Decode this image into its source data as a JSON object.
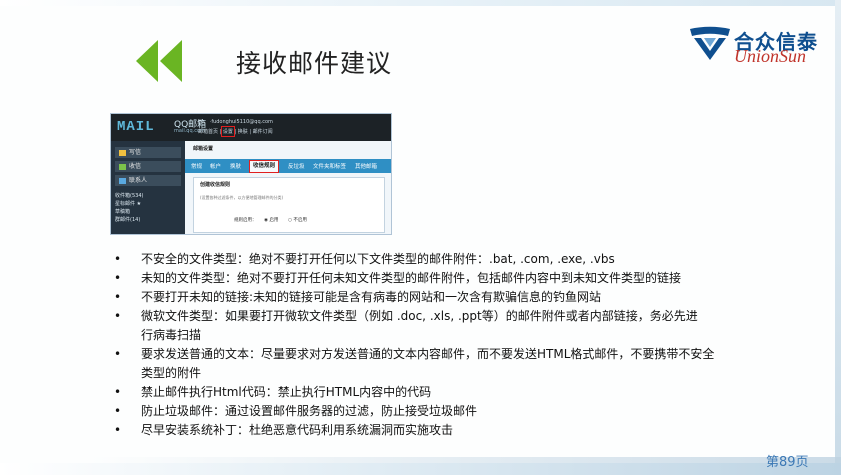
{
  "slide": {
    "title": "接收邮件建议",
    "page_label": "第89页"
  },
  "logo": {
    "name_cn": "合众信泰",
    "name_en": "UnionSun"
  },
  "screenshot": {
    "brand": "MAIL",
    "brand_qq": "QQ邮箱",
    "brand_domain": "mail.qq.com",
    "user_line": "Hi，           ·fudonghui5110@qq.com",
    "links_line": "邮箱首页 | 设置 | 换肤 | 邮件订阅",
    "sidebar_buttons": [
      "写信",
      "收信",
      "联系人"
    ],
    "sidebar_list": [
      "收件箱(534)",
      "星标邮件 ★",
      "草稿箱",
      "群邮件(14)"
    ],
    "panel_title": "邮箱设置",
    "tabs": [
      "常规",
      "帐户",
      "换肤",
      "收信规则",
      "反垃圾",
      "文件夹和标签",
      "其他邮箱"
    ],
    "active_tab": "收信规则",
    "sub_title": "创建收信规则",
    "sub_desc": "(设置各种过滤条件，以方便地管理邮件的分类)",
    "enable_label": "规则启用：",
    "enable_on": "◉ 启用",
    "enable_off": "○ 不启用"
  },
  "points": [
    {
      "text": "不安全的文件类型：绝对不要打开任何以下文件类型的邮件附件：.bat, .com, .exe, .vbs"
    },
    {
      "text": "未知的文件类型：绝对不要打开任何未知文件类型的邮件附件，包括邮件内容中到未知文件类型的链接"
    },
    {
      "text": "不要打开未知的链接:未知的链接可能是含有病毒的网站和一次含有欺骗信息的钓鱼网站"
    },
    {
      "text": "微软文件类型：如果要打开微软文件类型（例如 .doc, .xls, .ppt等）的邮件附件或者内部链接，务必先进",
      "cont": "行病毒扫描"
    },
    {
      "text": "要求发送普通的文本：尽量要求对方发送普通的文本内容邮件，而不要发送HTML格式邮件，不要携带不安全",
      "cont": "类型的附件"
    },
    {
      "text": "禁止邮件执行Html代码：禁止执行HTML内容中的代码"
    },
    {
      "text": "防止垃圾邮件：通过设置邮件服务器的过滤，防止接受垃圾邮件"
    },
    {
      "text": "尽早安装系统补丁：杜绝恶意代码利用系统漏洞而实施攻击"
    }
  ],
  "colors": {
    "chevron": "#6ab523",
    "logo_blue": "#0f4f8f",
    "logo_red": "#c0342b",
    "page_num": "#3b78b5",
    "highlight": "#e02020"
  },
  "icons": {
    "nav": "double-chevron-left-icon",
    "logo": "shield-v-logo-icon"
  }
}
